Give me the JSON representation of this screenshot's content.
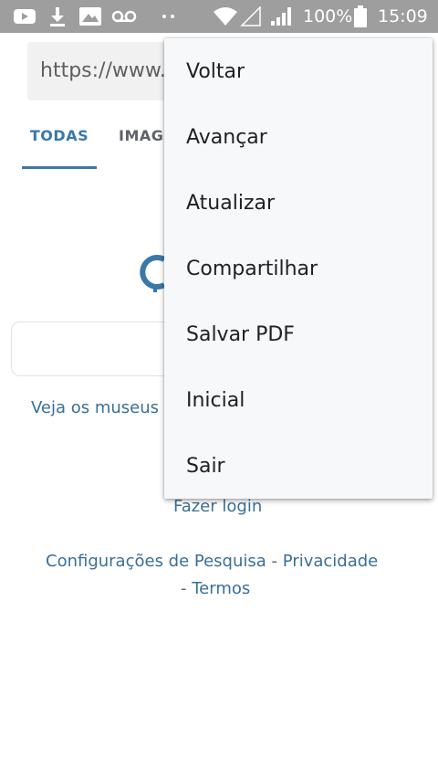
{
  "status_bar": {
    "icons": [
      "youtube-icon",
      "download-icon",
      "image-icon",
      "voicemail-icon",
      "more-notifications-icon",
      "wifi-icon",
      "signal-empty-icon",
      "signal-icon",
      "battery-icon"
    ],
    "battery": "100%",
    "time": "15:09"
  },
  "browser": {
    "url": "https://www.g",
    "tabs": [
      {
        "label": "TODAS",
        "active": true
      },
      {
        "label": "IMAGENS",
        "active": false
      }
    ],
    "promo_link": "Veja os museus n",
    "login_link": "Fazer login",
    "footer": {
      "settings": "Configurações de Pesquisa",
      "separator1": "-",
      "privacy": "Privacidade",
      "separator2": "-",
      "terms": "Termos"
    }
  },
  "menu": {
    "items": [
      "Voltar",
      "Avançar",
      "Atualizar",
      "Compartilhar",
      "Salvar PDF",
      "Inicial",
      "Sair"
    ]
  },
  "colors": {
    "status_bar": "#9e9e9e",
    "link": "#3a6f96",
    "accent": "#3b78a8",
    "menu_bg": "#f7f8fa"
  }
}
